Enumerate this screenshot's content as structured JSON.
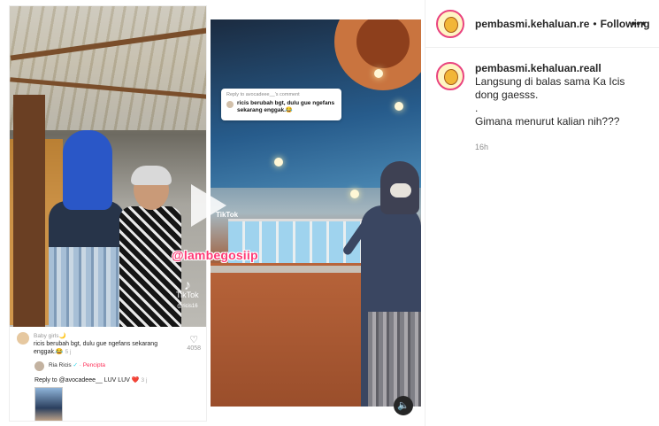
{
  "post": {
    "header": {
      "username": "pembasmi.kehaluan.re",
      "separator": "•",
      "follow_status": "Following",
      "more_label": "•••"
    },
    "caption": {
      "username": "pembasmi.kehaluan.reall",
      "line1": "Langsung di balas sama Ka Icis dong gaesss.",
      "line2": ".",
      "line3": "Gimana menurut kalian nih???",
      "time_ago": "16h"
    }
  },
  "media": {
    "left_screenshot": {
      "tiktok_logo_text": "TikTok",
      "tiktok_handle": "@ricis16",
      "comment": {
        "username": "Baby girls🌙",
        "text": "ricis berubah bgt, dulu gue ngefans sekarang enggak.😂",
        "time": "5 j",
        "like_count": "4058"
      },
      "reply": {
        "username": "Ria Ricis",
        "badge": "✓",
        "creator_label": "· Pencipta",
        "text_prefix": "Reply to @avocadeee__",
        "text_body": " LUV LUV",
        "heart": "❤️",
        "time": "3 j"
      }
    },
    "right_screenshot": {
      "reply_header": "Reply to avocadeee__'s comment",
      "reply_text": "ricis berubah bgt, dulu gue ngefans sekarang enggak.😂",
      "tiktok_logo_text": "TikTok",
      "watermark": "@lambegosiip",
      "sound_icon": "🔈"
    }
  }
}
